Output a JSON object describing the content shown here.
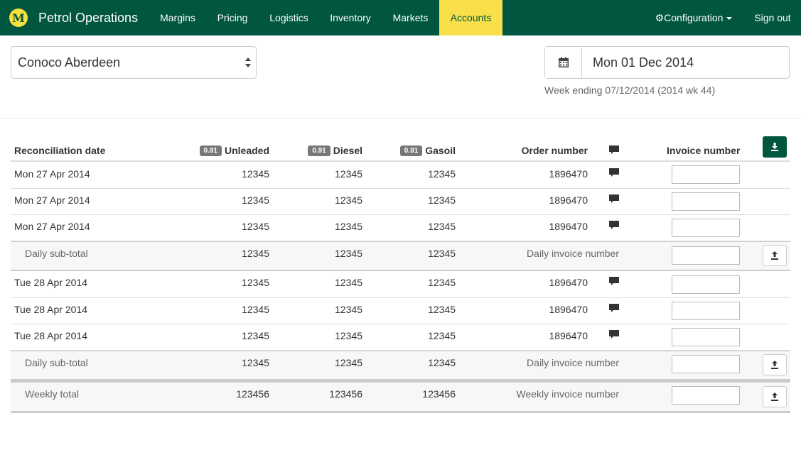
{
  "navbar": {
    "logo_letter": "M",
    "brand": "Petrol Operations",
    "items": [
      "Margins",
      "Pricing",
      "Logistics",
      "Inventory",
      "Markets",
      "Accounts"
    ],
    "active": "Accounts",
    "configuration": "Configuration",
    "sign_out": "Sign out",
    "brand_color": "#00563f",
    "active_color": "#f9e04b"
  },
  "site_select": {
    "value": "Conoco Aberdeen"
  },
  "date_picker": {
    "value": "Mon 01 Dec 2014",
    "icon": "calendar-icon"
  },
  "week_info": "Week ending 07/12/2014 (2014 wk 44)",
  "table": {
    "headers": {
      "date": "Reconciliation date",
      "unleaded_badge": "0.91",
      "unleaded": "Unleaded",
      "diesel_badge": "0.91",
      "diesel": "Diesel",
      "gasoil_badge": "0.91",
      "gasoil": "Gasoil",
      "order": "Order number",
      "invoice": "Invoice number"
    },
    "rows": [
      {
        "date": "Mon 27 Apr 2014",
        "unleaded": "12345",
        "diesel": "12345",
        "gasoil": "12345",
        "order": "1896470",
        "invoice": ""
      },
      {
        "date": "Mon 27 Apr 2014",
        "unleaded": "12345",
        "diesel": "12345",
        "gasoil": "12345",
        "order": "1896470",
        "invoice": ""
      },
      {
        "date": "Mon 27 Apr 2014",
        "unleaded": "12345",
        "diesel": "12345",
        "gasoil": "12345",
        "order": "1896470",
        "invoice": ""
      }
    ],
    "subtotal_1": {
      "label": "Daily sub-total",
      "unleaded": "12345",
      "diesel": "12345",
      "gasoil": "12345",
      "invoice_label": "Daily invoice number"
    },
    "rows_2": [
      {
        "date": "Tue 28 Apr 2014",
        "unleaded": "12345",
        "diesel": "12345",
        "gasoil": "12345",
        "order": "1896470",
        "invoice": ""
      },
      {
        "date": "Tue 28 Apr 2014",
        "unleaded": "12345",
        "diesel": "12345",
        "gasoil": "12345",
        "order": "1896470",
        "invoice": ""
      },
      {
        "date": "Tue 28 Apr 2014",
        "unleaded": "12345",
        "diesel": "12345",
        "gasoil": "12345",
        "order": "1896470",
        "invoice": ""
      }
    ],
    "subtotal_2": {
      "label": "Daily sub-total",
      "unleaded": "12345",
      "diesel": "12345",
      "gasoil": "12345",
      "invoice_label": "Daily invoice number"
    },
    "weekly": {
      "label": "Weekly total",
      "unleaded": "123456",
      "diesel": "123456",
      "gasoil": "123456",
      "invoice_label": "Weekly invoice number"
    }
  }
}
